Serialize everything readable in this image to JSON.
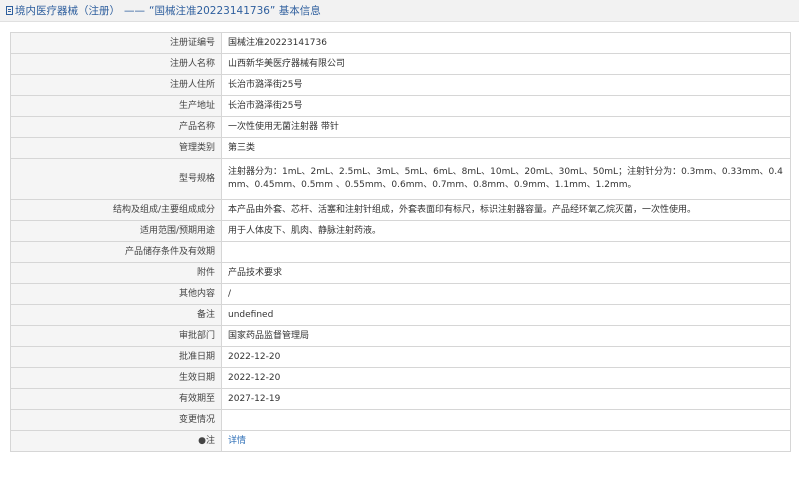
{
  "header": {
    "category": "境内医疗器械（注册）",
    "separator": "——",
    "title": "“国械注准20223141736” 基本信息"
  },
  "rows": [
    {
      "label": "注册证编号",
      "value": "国械注准20223141736"
    },
    {
      "label": "注册人名称",
      "value": "山西新华美医疗器械有限公司"
    },
    {
      "label": "注册人住所",
      "value": "长治市潞泽街25号"
    },
    {
      "label": "生产地址",
      "value": "长治市潞泽街25号"
    },
    {
      "label": "产品名称",
      "value": "一次性使用无菌注射器 带针"
    },
    {
      "label": "管理类别",
      "value": "第三类"
    },
    {
      "label": "型号规格",
      "value": "注射器分为：1mL、2mL、2.5mL、3mL、5mL、6mL、8mL、10mL、20mL、30mL、50mL；注射针分为：0.3mm、0.33mm、0.4mm、0.45mm、0.5mm 、0.55mm、0.6mm、0.7mm、0.8mm、0.9mm、1.1mm、1.2mm。"
    },
    {
      "label": "结构及组成/主要组成成分",
      "value": "本产品由外套、芯杆、活塞和注射针组成，外套表面印有标尺，标识注射器容量。产品经环氧乙烷灭菌，一次性使用。"
    },
    {
      "label": "适用范围/预期用途",
      "value": "用于人体皮下、肌肉、静脉注射药液。"
    },
    {
      "label": "产品储存条件及有效期",
      "value": ""
    },
    {
      "label": "附件",
      "value": "产品技术要求"
    },
    {
      "label": "其他内容",
      "value": "/"
    },
    {
      "label": "备注",
      "value": "undefined"
    },
    {
      "label": "审批部门",
      "value": "国家药品监督管理局"
    },
    {
      "label": "批准日期",
      "value": "2022-12-20"
    },
    {
      "label": "生效日期",
      "value": "2022-12-20"
    },
    {
      "label": "有效期至",
      "value": "2027-12-19"
    },
    {
      "label": "变更情况",
      "value": ""
    },
    {
      "label": "●注",
      "value": "详情"
    }
  ]
}
